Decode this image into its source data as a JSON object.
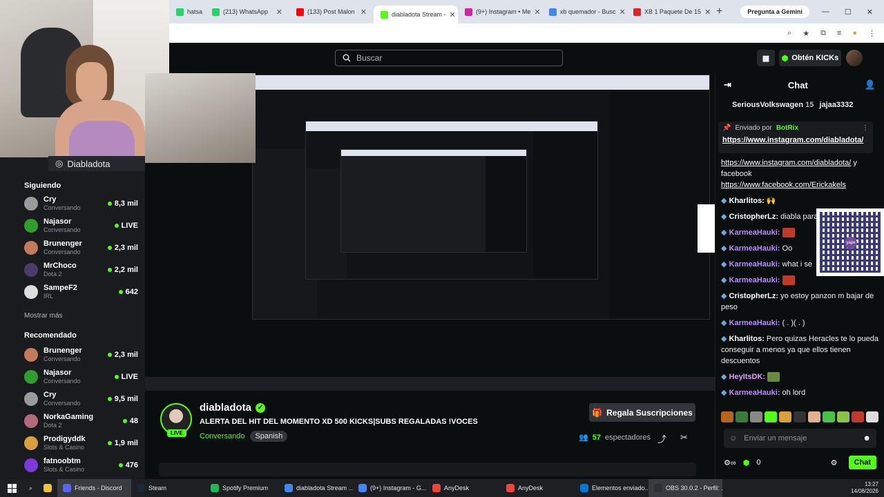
{
  "browser": {
    "tabs": [
      {
        "label": "hatsa",
        "color": "#25d366"
      },
      {
        "label": "(213) WhatsApp",
        "color": "#25d366"
      },
      {
        "label": "(133) Post Malon",
        "color": "#ff0000"
      },
      {
        "label": "diabladota Stream -",
        "color": "#53fc18"
      },
      {
        "label": "(9+) Instagram • Me",
        "color": "#d6249f"
      },
      {
        "label": "xb quemador - Busc",
        "color": "#4285f4"
      },
      {
        "label": "XB 1 Paquete De 15",
        "color": "#e02424"
      }
    ],
    "new_tab": "+",
    "gemini": "Pregunta a Gemini"
  },
  "kick": {
    "search_placeholder": "Buscar",
    "get_kicks": "Obtén KICKs"
  },
  "channel_tag": "Diabladota",
  "sidebar": {
    "following_title": "Siguiendo",
    "following": [
      {
        "name": "Cry",
        "sub": "Conversando",
        "viewers": "8,3 mil",
        "color": "#9a9a9a"
      },
      {
        "name": "Najasor",
        "sub": "Conversando",
        "viewers": "LIVE",
        "color": "#2f9e2f"
      },
      {
        "name": "Brunenger",
        "sub": "Conversando",
        "viewers": "2,3 mil",
        "color": "#c07b5a"
      },
      {
        "name": "MrChoco",
        "sub": "Dota 2",
        "viewers": "2,2 mil",
        "color": "#4a3b6b"
      },
      {
        "name": "SampeF2",
        "sub": "IRL",
        "viewers": "642",
        "color": "#dddddd"
      }
    ],
    "show_more": "Mostrar más",
    "recommended_title": "Recomendado",
    "recommended": [
      {
        "name": "Brunenger",
        "sub": "Conversando",
        "viewers": "2,3 mil",
        "color": "#c07b5a"
      },
      {
        "name": "Najasor",
        "sub": "Conversando",
        "viewers": "LIVE",
        "color": "#2f9e2f"
      },
      {
        "name": "Cry",
        "sub": "Conversando",
        "viewers": "9,5 mil",
        "color": "#9a9a9a"
      },
      {
        "name": "NorkaGaming",
        "sub": "Dota 2",
        "viewers": "48",
        "color": "#b06a7a"
      },
      {
        "name": "Prodigyddk",
        "sub": "Slots & Casino",
        "viewers": "1,9 mil",
        "color": "#d9a13b"
      },
      {
        "name": "fatnoobtm",
        "sub": "Slots & Casino",
        "viewers": "476",
        "color": "#7a3bd9"
      }
    ]
  },
  "stream": {
    "streamer": "diabladota",
    "title": "ALERTA DEL HIT DEL MOMENTO XD 500 KICKS|SUBS REGALADAS !VOCES",
    "category": "Conversando",
    "tag": "Spanish",
    "live": "LIVE",
    "subs_button": "Regala Suscripciones",
    "viewers": "57",
    "viewers_label": "espectadores"
  },
  "chat": {
    "title": "Chat",
    "top_user": "SeriousVolkswagen",
    "top_count": "15",
    "top_user2": "jajaa3332",
    "pinned_by": "Enviado por",
    "pinned_user": "BotRix",
    "pinned_link": "https://www.instagram.com/diabladota/",
    "messages": [
      {
        "user": "",
        "color": "#fff",
        "text": "",
        "link1": "https://www.instagram.com/diabladota/",
        "mid": " y facebook ",
        "link2": "https://www.facebook.com/Erickakels"
      },
      {
        "user": "Kharlitos:",
        "color": "#ffffff",
        "text": " 🙌"
      },
      {
        "user": "CristopherLz:",
        "color": "#ffffff",
        "text": " diabla para q"
      },
      {
        "user": "KarmeaHauki:",
        "color": "#b78cff",
        "text": " "
      },
      {
        "user": "KarmeaHauki:",
        "color": "#b78cff",
        "text": " Oo"
      },
      {
        "user": "KarmeaHauki:",
        "color": "#b78cff",
        "text": " what i se"
      },
      {
        "user": "KarmeaHauki:",
        "color": "#b78cff",
        "text": " "
      },
      {
        "user": "CristopherLz:",
        "color": "#ffffff",
        "text": " yo estoy panzon m bajar de peso"
      },
      {
        "user": "KarmeaHauki:",
        "color": "#b78cff",
        "text": " ( . )( . )"
      },
      {
        "user": "Kharlitos:",
        "color": "#ffffff",
        "text": " Pero quizas Heracles te lo pueda conseguir a menos ya que ellos tienen descuentos"
      },
      {
        "user": "HeyItsDK:",
        "color": "#e39cff",
        "text": " "
      },
      {
        "user": "KarmeaHauki:",
        "color": "#b78cff",
        "text": " oh lord"
      }
    ],
    "qr_label": "yape",
    "input_placeholder": "Enviar un mensaje",
    "kicks": "0",
    "send": "Chat"
  },
  "taskbar": {
    "items": [
      {
        "label": "Friends - Discord",
        "color": "#5865f2"
      },
      {
        "label": "Steam",
        "color": "#1b2838"
      },
      {
        "label": "Spotify Premium",
        "color": "#1db954"
      },
      {
        "label": "diabladota Stream ...",
        "color": "#4285f4"
      },
      {
        "label": "(9+) Instagram - G...",
        "color": "#4285f4"
      },
      {
        "label": "AnyDesk",
        "color": "#ef443b"
      },
      {
        "label": "AnyDesk",
        "color": "#ef443b"
      },
      {
        "label": "Elementos enviado...",
        "color": "#0078d4"
      },
      {
        "label": "OBS 30.0.2 - Perfil: ...",
        "color": "#302e31"
      }
    ],
    "time": "13:27",
    "date": "14/08/2026"
  }
}
